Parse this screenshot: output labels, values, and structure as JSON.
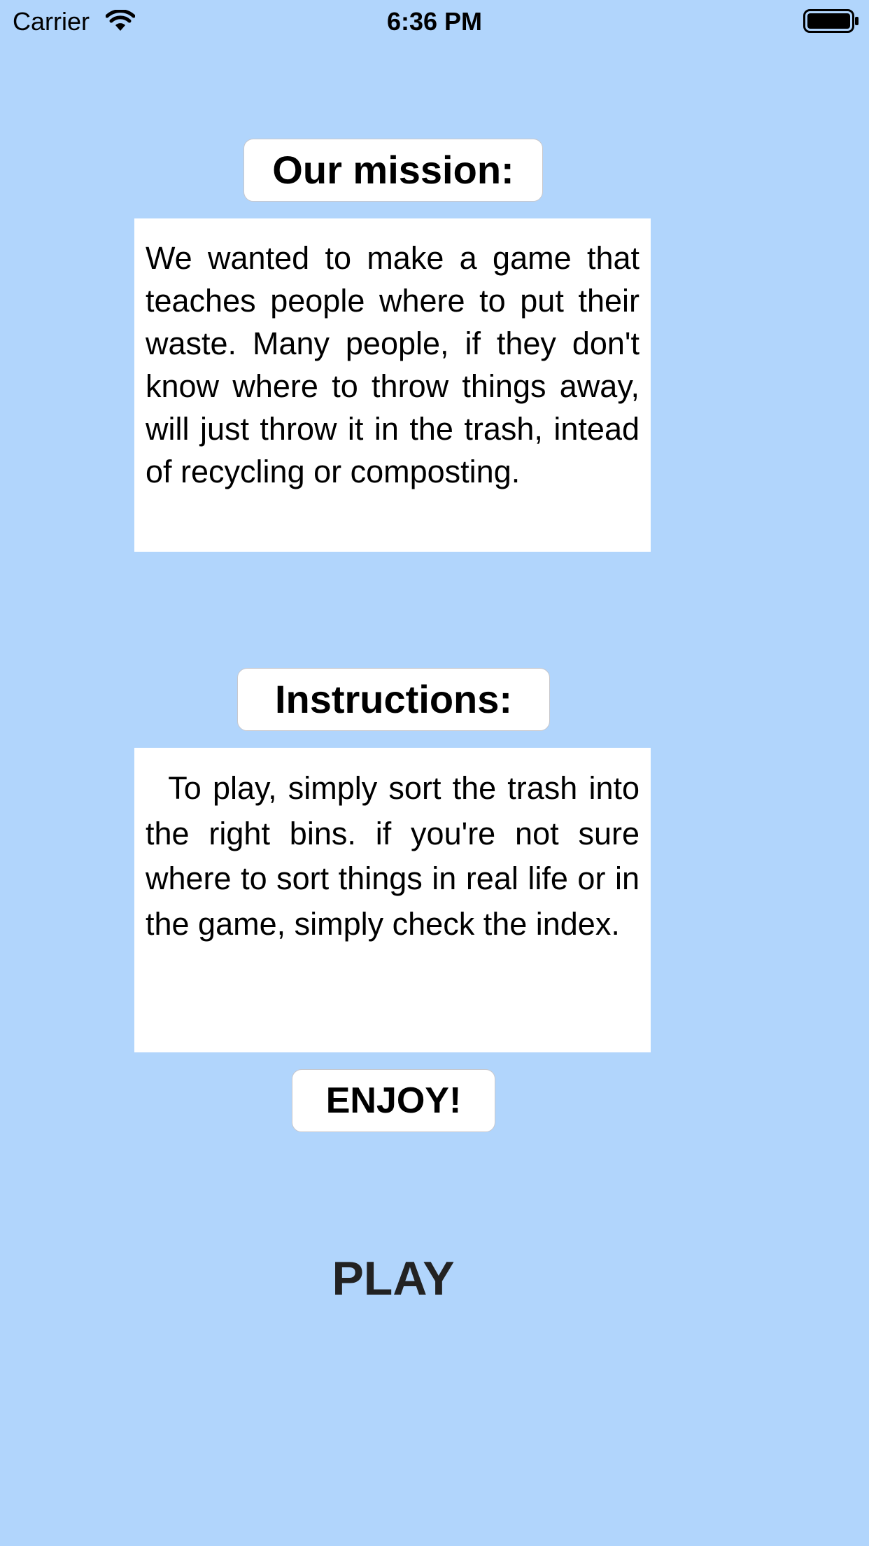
{
  "status_bar": {
    "carrier": "Carrier",
    "time": "6:36 PM",
    "icons": [
      "wifi-icon",
      "battery-icon"
    ]
  },
  "mission": {
    "heading": "Our mission:",
    "body": "We wanted to make a game that teaches people where to put their waste. Many people, if they don't know where to throw things away, will just throw it in the trash, intead of recycling or composting."
  },
  "instructions": {
    "heading": "Instructions:",
    "body": "  To play, simply sort the trash into the right bins. if you're not sure where to sort things in real life or in the game, simply check the index."
  },
  "enjoy_label": "ENJOY!",
  "play_label": "PLAY",
  "colors": {
    "background": "#b1d5fc",
    "card": "#ffffff",
    "play_text": "#222222"
  }
}
